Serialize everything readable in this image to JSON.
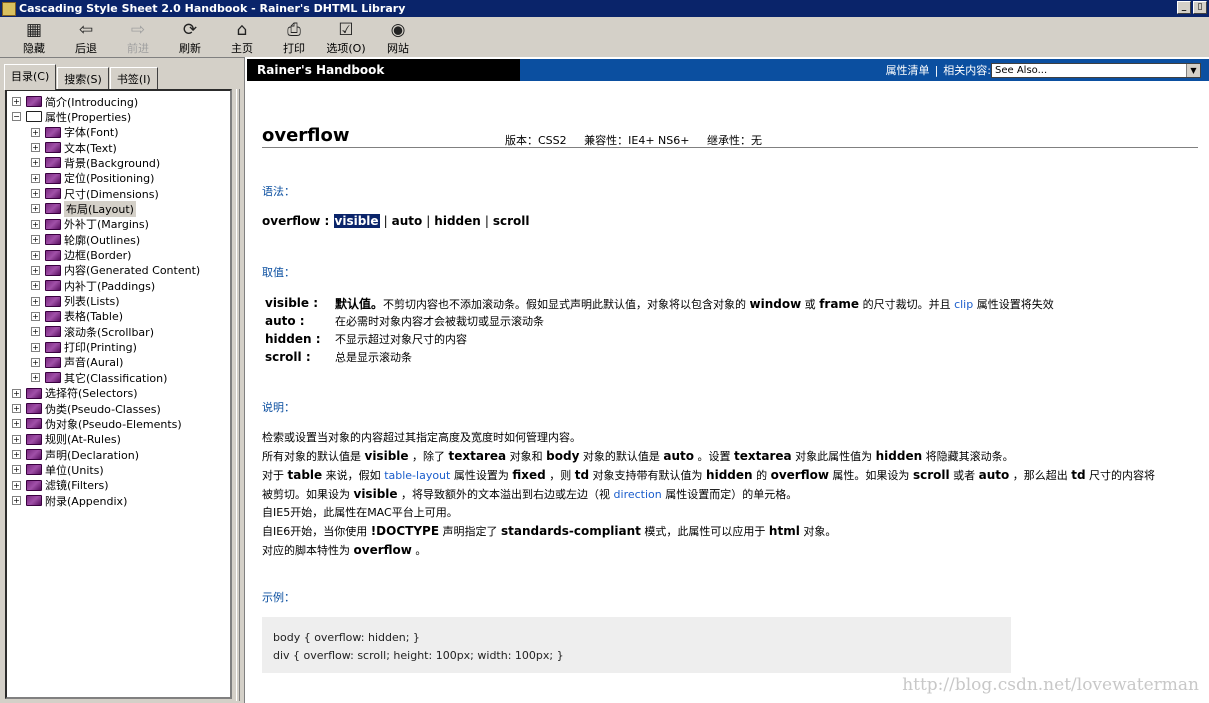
{
  "window": {
    "title": "Cascading Style Sheet 2.0 Handbook - Rainer's DHTML Library",
    "ctrl": [
      "_",
      "▯"
    ]
  },
  "toolbar": [
    {
      "label": "隐藏",
      "icon": "▦",
      "name": "hide-button",
      "disabled": false
    },
    {
      "label": "后退",
      "icon": "⇦",
      "name": "back-button",
      "disabled": false
    },
    {
      "label": "前进",
      "icon": "⇨",
      "name": "forward-button",
      "disabled": true
    },
    {
      "label": "刷新",
      "icon": "⟳",
      "name": "refresh-button",
      "disabled": false
    },
    {
      "label": "主页",
      "icon": "⌂",
      "name": "home-button",
      "disabled": false
    },
    {
      "label": "打印",
      "icon": "⎙",
      "name": "print-button",
      "disabled": false
    },
    {
      "label": "选项(O)",
      "icon": "☑",
      "name": "options-button",
      "disabled": false
    },
    {
      "label": "网站",
      "icon": "◉",
      "name": "website-button",
      "disabled": false
    }
  ],
  "tabs": [
    "目录(C)",
    "搜索(S)",
    "书签(I)"
  ],
  "tree": [
    {
      "label": "简介(Introducing)",
      "level": 0,
      "pm": "+",
      "open": false
    },
    {
      "label": "属性(Properties)",
      "level": 0,
      "pm": "−",
      "open": true
    },
    {
      "label": "字体(Font)",
      "level": 1,
      "pm": "+",
      "open": false
    },
    {
      "label": "文本(Text)",
      "level": 1,
      "pm": "+",
      "open": false
    },
    {
      "label": "背景(Background)",
      "level": 1,
      "pm": "+",
      "open": false
    },
    {
      "label": "定位(Positioning)",
      "level": 1,
      "pm": "+",
      "open": false
    },
    {
      "label": "尺寸(Dimensions)",
      "level": 1,
      "pm": "+",
      "open": false
    },
    {
      "label": "布局(Layout)",
      "level": 1,
      "pm": "+",
      "open": false,
      "selected": true
    },
    {
      "label": "外补丁(Margins)",
      "level": 1,
      "pm": "+",
      "open": false
    },
    {
      "label": "轮廓(Outlines)",
      "level": 1,
      "pm": "+",
      "open": false
    },
    {
      "label": "边框(Border)",
      "level": 1,
      "pm": "+",
      "open": false
    },
    {
      "label": "内容(Generated Content)",
      "level": 1,
      "pm": "+",
      "open": false
    },
    {
      "label": "内补丁(Paddings)",
      "level": 1,
      "pm": "+",
      "open": false
    },
    {
      "label": "列表(Lists)",
      "level": 1,
      "pm": "+",
      "open": false
    },
    {
      "label": "表格(Table)",
      "level": 1,
      "pm": "+",
      "open": false
    },
    {
      "label": "滚动条(Scrollbar)",
      "level": 1,
      "pm": "+",
      "open": false
    },
    {
      "label": "打印(Printing)",
      "level": 1,
      "pm": "+",
      "open": false
    },
    {
      "label": "声音(Aural)",
      "level": 1,
      "pm": "+",
      "open": false
    },
    {
      "label": "其它(Classification)",
      "level": 1,
      "pm": "+",
      "open": false
    },
    {
      "label": "选择符(Selectors)",
      "level": 0,
      "pm": "+",
      "open": false
    },
    {
      "label": "伪类(Pseudo-Classes)",
      "level": 0,
      "pm": "+",
      "open": false
    },
    {
      "label": "伪对象(Pseudo-Elements)",
      "level": 0,
      "pm": "+",
      "open": false
    },
    {
      "label": "规则(At-Rules)",
      "level": 0,
      "pm": "+",
      "open": false
    },
    {
      "label": "声明(Declaration)",
      "level": 0,
      "pm": "+",
      "open": false
    },
    {
      "label": "单位(Units)",
      "level": 0,
      "pm": "+",
      "open": false
    },
    {
      "label": "滤镜(Filters)",
      "level": 0,
      "pm": "+",
      "open": false
    },
    {
      "label": "附录(Appendix)",
      "level": 0,
      "pm": "+",
      "open": false
    }
  ],
  "header": {
    "brand": "Rainer's Handbook",
    "prop_list": "属性清单",
    "sep": "|",
    "related": "相关内容:",
    "see_also": "See Also..."
  },
  "page": {
    "title": "overflow",
    "version": "版本：CSS2",
    "compat": "兼容性：IE4+ NS6+",
    "inherit": "继承性：无",
    "syntax_head": "语法：",
    "syntax_name": "overflow :",
    "syntax_values": [
      "visible",
      "auto",
      "hidden",
      "scroll"
    ],
    "values_head": "取值：",
    "values": [
      {
        "k": "visible :",
        "parts": [
          [
            "b",
            "默认值。"
          ],
          [
            "t",
            "不剪切内容也不添加滚动条。假如显式声明此默认值，对象将以包含对象的 "
          ],
          [
            "b",
            "window"
          ],
          [
            "t",
            " 或 "
          ],
          [
            "b",
            "frame"
          ],
          [
            "t",
            " 的尺寸裁切。并且 "
          ],
          [
            "a",
            "clip"
          ],
          [
            "t",
            " 属性设置将失效"
          ]
        ]
      },
      {
        "k": "auto :",
        "parts": [
          [
            "t",
            "在必需时对象内容才会被裁切或显示滚动条"
          ]
        ]
      },
      {
        "k": "hidden :",
        "parts": [
          [
            "t",
            "不显示超过对象尺寸的内容"
          ]
        ]
      },
      {
        "k": "scroll :",
        "parts": [
          [
            "t",
            "总是显示滚动条"
          ]
        ]
      }
    ],
    "desc_head": "说明：",
    "desc": [
      [
        [
          "t",
          "检索或设置当对象的内容超过其指定高度及宽度时如何管理内容。"
        ]
      ],
      [
        [
          "t",
          "所有对象的默认值是 "
        ],
        [
          "b",
          "visible"
        ],
        [
          "t",
          " ，除了 "
        ],
        [
          "b",
          "textarea"
        ],
        [
          "t",
          " 对象和 "
        ],
        [
          "b",
          "body"
        ],
        [
          "t",
          " 对象的默认值是 "
        ],
        [
          "b",
          "auto"
        ],
        [
          "t",
          " 。设置 "
        ],
        [
          "b",
          "textarea"
        ],
        [
          "t",
          " 对象此属性值为 "
        ],
        [
          "b",
          "hidden"
        ],
        [
          "t",
          " 将隐藏其滚动条。"
        ]
      ],
      [
        [
          "t",
          "对于 "
        ],
        [
          "b",
          "table"
        ],
        [
          "t",
          " 来说，假如 "
        ],
        [
          "a",
          "table-layout"
        ],
        [
          "t",
          " 属性设置为 "
        ],
        [
          "b",
          "fixed"
        ],
        [
          "t",
          " ，则 "
        ],
        [
          "b",
          "td"
        ],
        [
          "t",
          " 对象支持带有默认值为 "
        ],
        [
          "b",
          "hidden"
        ],
        [
          "t",
          " 的 "
        ],
        [
          "b",
          "overflow"
        ],
        [
          "t",
          " 属性。如果设为 "
        ],
        [
          "b",
          "scroll"
        ],
        [
          "t",
          " 或者 "
        ],
        [
          "b",
          "auto"
        ],
        [
          "t",
          " ，那么超出 "
        ],
        [
          "b",
          "td"
        ],
        [
          "t",
          " 尺寸的内容将"
        ]
      ],
      [
        [
          "t",
          "被剪切。如果设为 "
        ],
        [
          "b",
          "visible"
        ],
        [
          "t",
          " ，将导致额外的文本溢出到右边或左边（视 "
        ],
        [
          "a",
          "direction"
        ],
        [
          "t",
          " 属性设置而定）的单元格。"
        ]
      ],
      [
        [
          "t",
          "自IE5开始，此属性在MAC平台上可用。"
        ]
      ],
      [
        [
          "t",
          "自IE6开始，当你使用 "
        ],
        [
          "b",
          "!DOCTYPE"
        ],
        [
          "t",
          " 声明指定了 "
        ],
        [
          "b",
          "standards-compliant"
        ],
        [
          "t",
          " 模式，此属性可以应用于 "
        ],
        [
          "b",
          "html"
        ],
        [
          "t",
          " 对象。"
        ]
      ],
      [
        [
          "t",
          "对应的脚本特性为 "
        ],
        [
          "b",
          "overflow"
        ],
        [
          "t",
          " 。"
        ]
      ]
    ],
    "example_head": "示例：",
    "example": [
      "body { overflow: hidden; }",
      "div { overflow: scroll; height: 100px; width: 100px; }"
    ]
  },
  "watermark": "http://blog.csdn.net/lovewaterman"
}
